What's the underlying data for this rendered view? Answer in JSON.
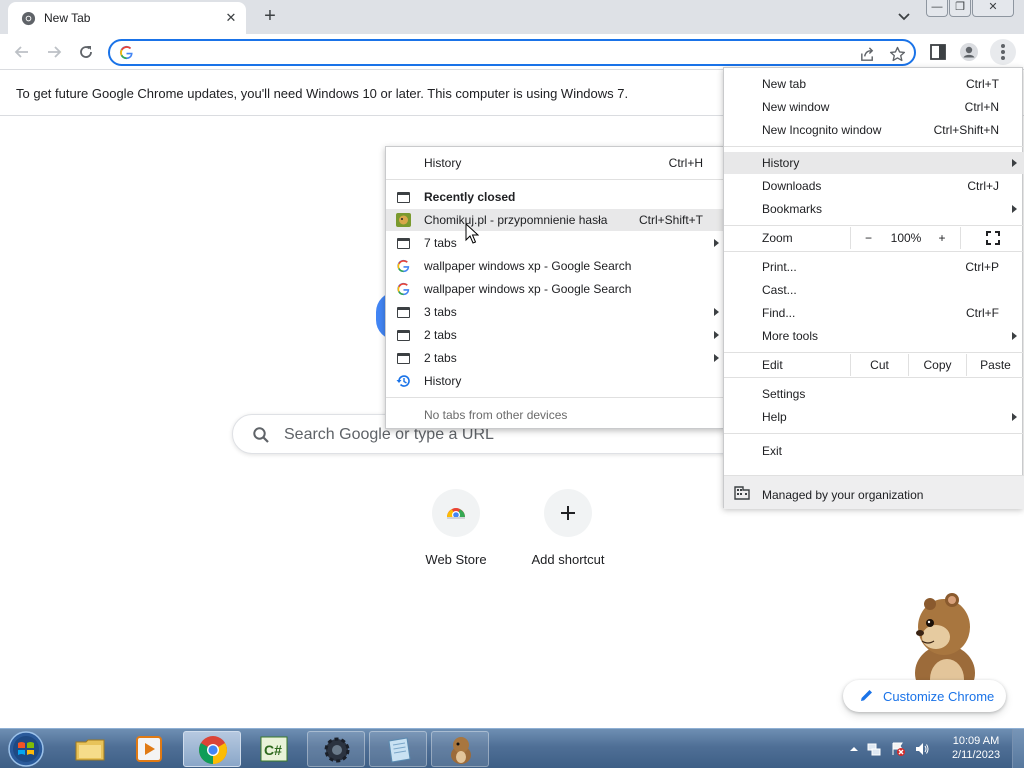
{
  "tab": {
    "title": "New Tab",
    "close": "✕",
    "new_tab": "+"
  },
  "window": {
    "minimize": "—",
    "restore": "❐",
    "close": "✕"
  },
  "omnibox": {
    "value": "",
    "placeholder": ""
  },
  "infobar": {
    "text": "To get future Google Chrome updates, you'll need Windows 10 or later. This computer is using Windows 7."
  },
  "ntp": {
    "search_placeholder": "Search Google or type a URL",
    "shortcuts": [
      {
        "label": "Web Store"
      },
      {
        "label": "Add shortcut"
      }
    ],
    "customize": "Customize Chrome"
  },
  "main_menu": {
    "new_tab": {
      "label": "New tab",
      "shortcut": "Ctrl+T"
    },
    "new_window": {
      "label": "New window",
      "shortcut": "Ctrl+N"
    },
    "incognito": {
      "label": "New Incognito window",
      "shortcut": "Ctrl+Shift+N"
    },
    "history": {
      "label": "History"
    },
    "downloads": {
      "label": "Downloads",
      "shortcut": "Ctrl+J"
    },
    "bookmarks": {
      "label": "Bookmarks"
    },
    "zoom": {
      "label": "Zoom",
      "minus": "−",
      "level": "100%",
      "plus": "+"
    },
    "print": {
      "label": "Print...",
      "shortcut": "Ctrl+P"
    },
    "cast": {
      "label": "Cast..."
    },
    "find": {
      "label": "Find...",
      "shortcut": "Ctrl+F"
    },
    "more_tools": {
      "label": "More tools"
    },
    "edit": {
      "label": "Edit",
      "cut": "Cut",
      "copy": "Copy",
      "paste": "Paste"
    },
    "settings": {
      "label": "Settings"
    },
    "help": {
      "label": "Help"
    },
    "exit": {
      "label": "Exit"
    },
    "managed": {
      "label": "Managed by your organization"
    }
  },
  "history_menu": {
    "history_header": {
      "label": "History",
      "shortcut": "Ctrl+H"
    },
    "recently_closed": "Recently closed",
    "items": [
      {
        "label": "Chomikuj.pl - przypomnienie hasła",
        "shortcut": "Ctrl+Shift+T",
        "icon": "chomikuj-favicon"
      },
      {
        "label": "7 tabs",
        "icon": "tabs-icon",
        "submenu": true
      },
      {
        "label": "wallpaper windows xp - Google Search",
        "icon": "google-icon"
      },
      {
        "label": "wallpaper windows xp - Google Search",
        "icon": "google-icon"
      },
      {
        "label": "3 tabs",
        "icon": "tabs-icon",
        "submenu": true
      },
      {
        "label": "2 tabs",
        "icon": "tabs-icon",
        "submenu": true
      },
      {
        "label": "2 tabs",
        "icon": "tabs-icon",
        "submenu": true
      },
      {
        "label": "History",
        "icon": "history-icon"
      }
    ],
    "no_other_devices": "No tabs from other devices"
  },
  "taskbar": {
    "apps": [
      "file-explorer-icon",
      "media-player-icon",
      "chrome-icon",
      "csharp-icon",
      "cheat-engine-icon",
      "notepad-icon",
      "hamster-icon"
    ],
    "time": "10:09 AM",
    "date": "2/11/2023"
  },
  "colors": {
    "accent": "#1a73e8",
    "menu_highlight": "#e8e8e9",
    "taskbar": "#4f6f96"
  }
}
